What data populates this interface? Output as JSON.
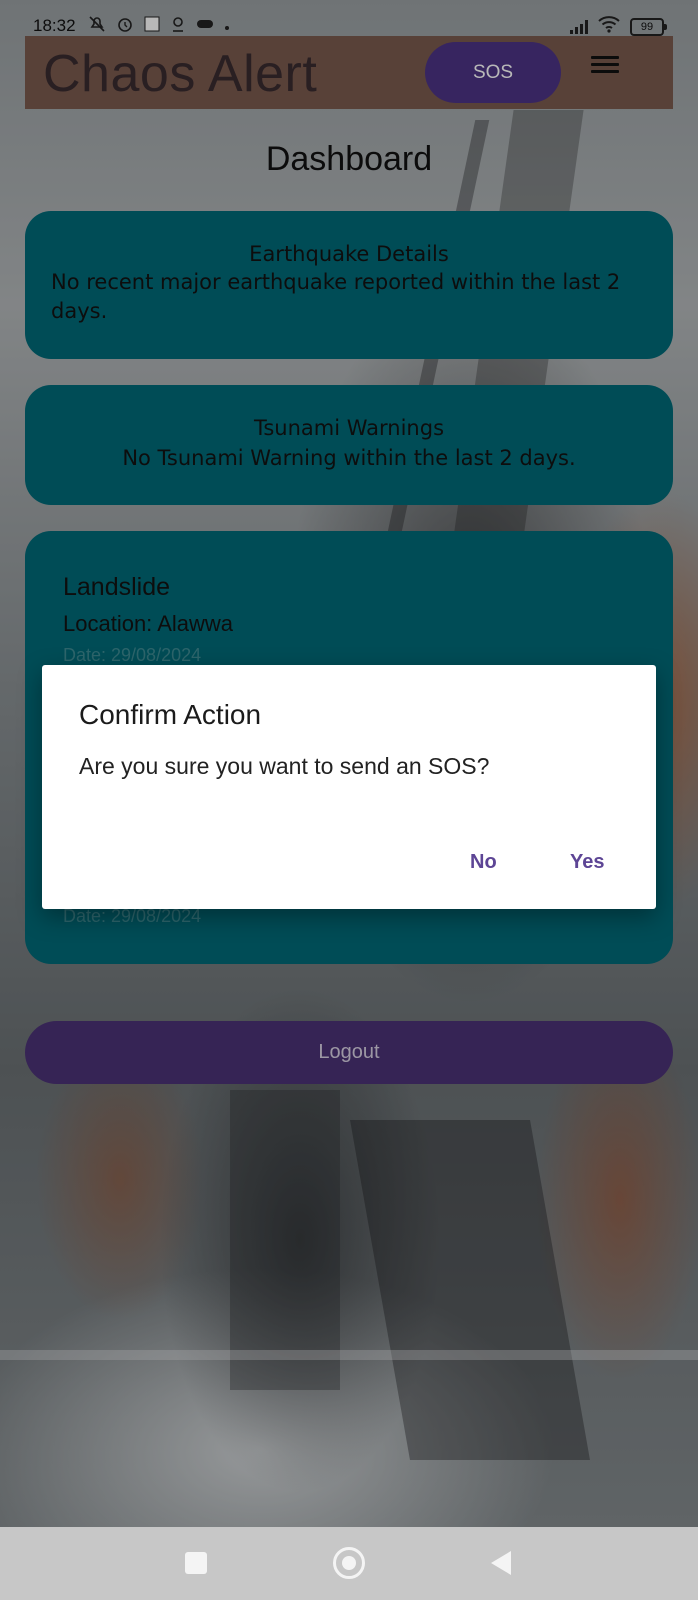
{
  "status_bar": {
    "time": "18:32",
    "battery": "99",
    "icons_left": [
      "mute-icon",
      "alarm-icon",
      "square-icon",
      "location-icon",
      "game-icon",
      "dot-icon"
    ],
    "icons_right": [
      "signal-icon",
      "wifi-icon",
      "battery-icon"
    ]
  },
  "app_bar": {
    "title": "Chaos Alert",
    "sos_label": "SOS",
    "menu_icon": "hamburger-menu-icon"
  },
  "dashboard": {
    "title": "Dashboard",
    "earthquake": {
      "heading": "Earthquake Details",
      "body": "No recent major earthquake reported within the last 2 days."
    },
    "tsunami": {
      "heading": "Tsunami Warnings",
      "body": "No Tsunami Warning within the last 2 days."
    },
    "alerts": [
      {
        "type": "Landslide",
        "location": "Location: Alawwa",
        "date": "Date: 29/08/2024"
      },
      {
        "date": "Date: 29/08/2024"
      }
    ],
    "logout_label": "Logout"
  },
  "dialog": {
    "title": "Confirm Action",
    "message": "Are you sure you want to send an SOS?",
    "no_label": "No",
    "yes_label": "Yes"
  },
  "nav_bar": {
    "icons": [
      "recents-icon",
      "home-icon",
      "back-icon"
    ]
  },
  "colors": {
    "app_bar": "#7a5a4e",
    "sos_button": "#4d3486",
    "card": "#016a78",
    "logout_button": "#4c3276",
    "dialog_action": "#5d4595"
  }
}
